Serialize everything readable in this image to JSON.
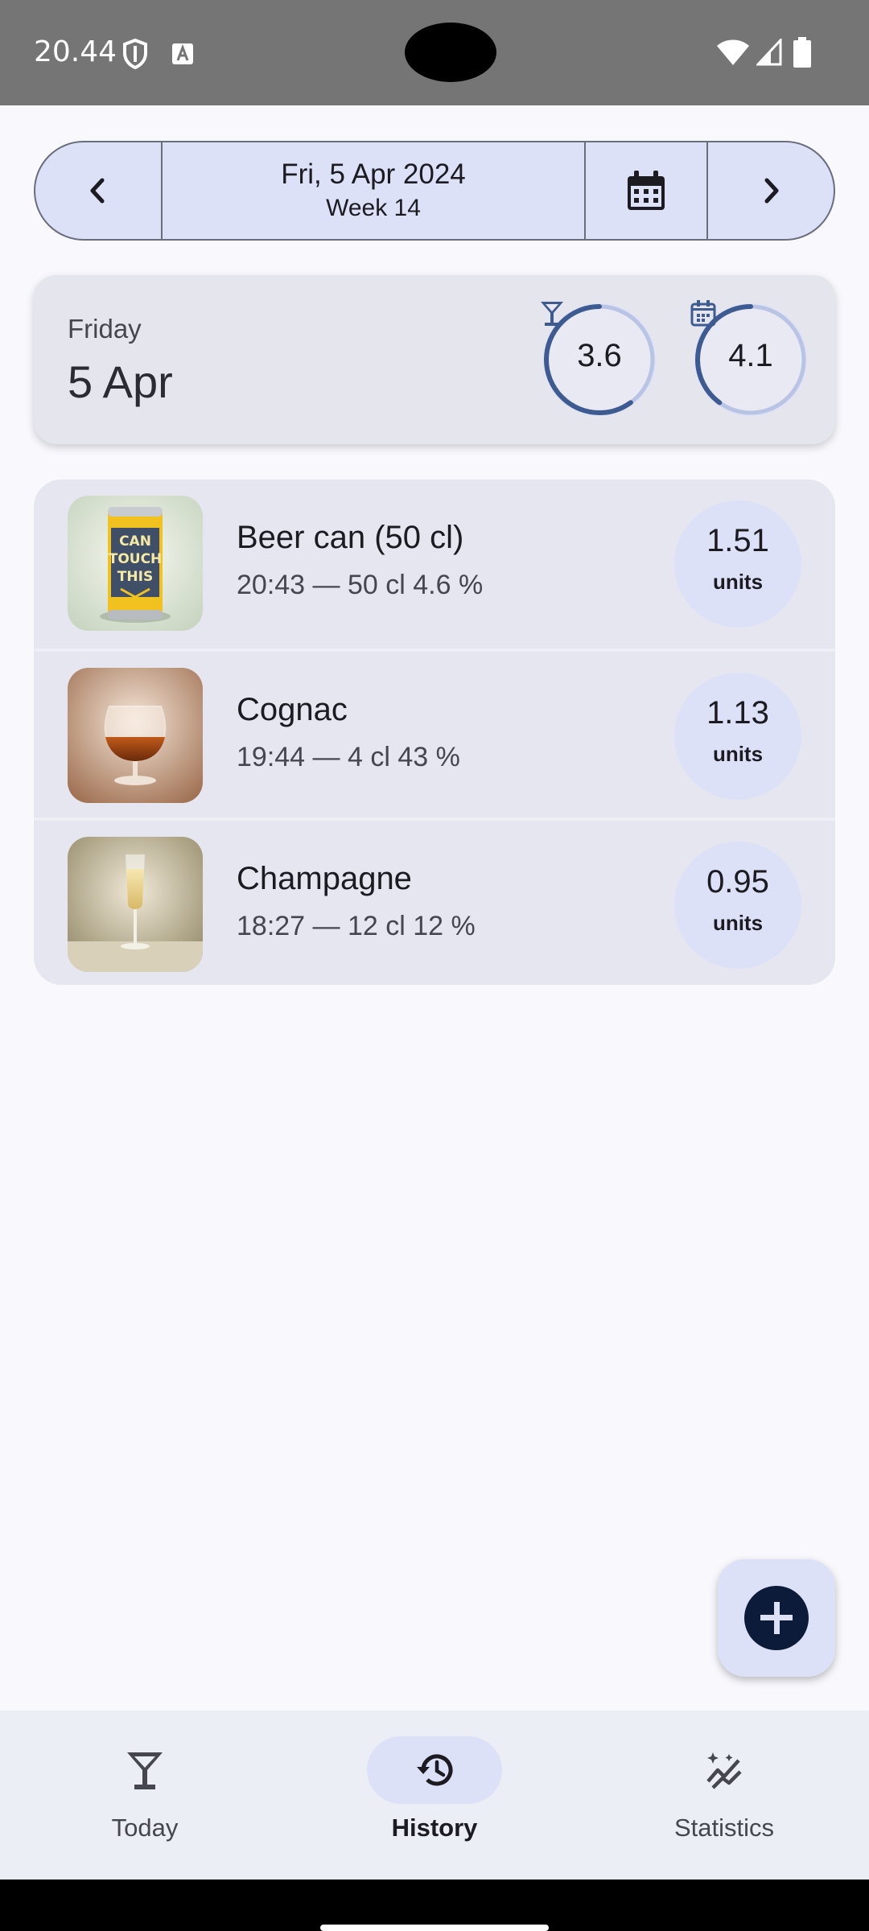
{
  "status_bar": {
    "time": "20.44"
  },
  "date_nav": {
    "date_label": "Fri, 5 Apr 2024",
    "week_label": "Week 14"
  },
  "summary": {
    "weekday": "Friday",
    "date": "5 Apr",
    "day_units": "3.6",
    "day_units_progress": 0.6,
    "week_units": "4.1",
    "week_units_progress": 0.4
  },
  "drinks": [
    {
      "name": "Beer can (50 cl)",
      "detail": "20:43 — 50 cl 4.6 %",
      "units": "1.51",
      "units_label": "units",
      "image": "beer-can-image",
      "can_text": [
        "CAN",
        "TOUCH",
        "THIS"
      ]
    },
    {
      "name": "Cognac",
      "detail": "19:44 — 4 cl 43 %",
      "units": "1.13",
      "units_label": "units",
      "image": "cognac-glass-image"
    },
    {
      "name": "Champagne",
      "detail": "18:27 — 12 cl 12 %",
      "units": "0.95",
      "units_label": "units",
      "image": "champagne-flute-image"
    }
  ],
  "fab": {
    "icon": "plus-icon"
  },
  "bottom_nav": {
    "items": [
      {
        "label": "Today",
        "icon": "cocktail-glass-icon",
        "active": false
      },
      {
        "label": "History",
        "icon": "history-icon",
        "active": true
      },
      {
        "label": "Statistics",
        "icon": "statistics-icon",
        "active": false
      }
    ]
  },
  "colors": {
    "accent": "#3d5a91",
    "accent_track": "#b9c4e4",
    "container": "#dde1f8",
    "background": "#f8f8fd",
    "fab_icon": "#0d1b3a"
  }
}
